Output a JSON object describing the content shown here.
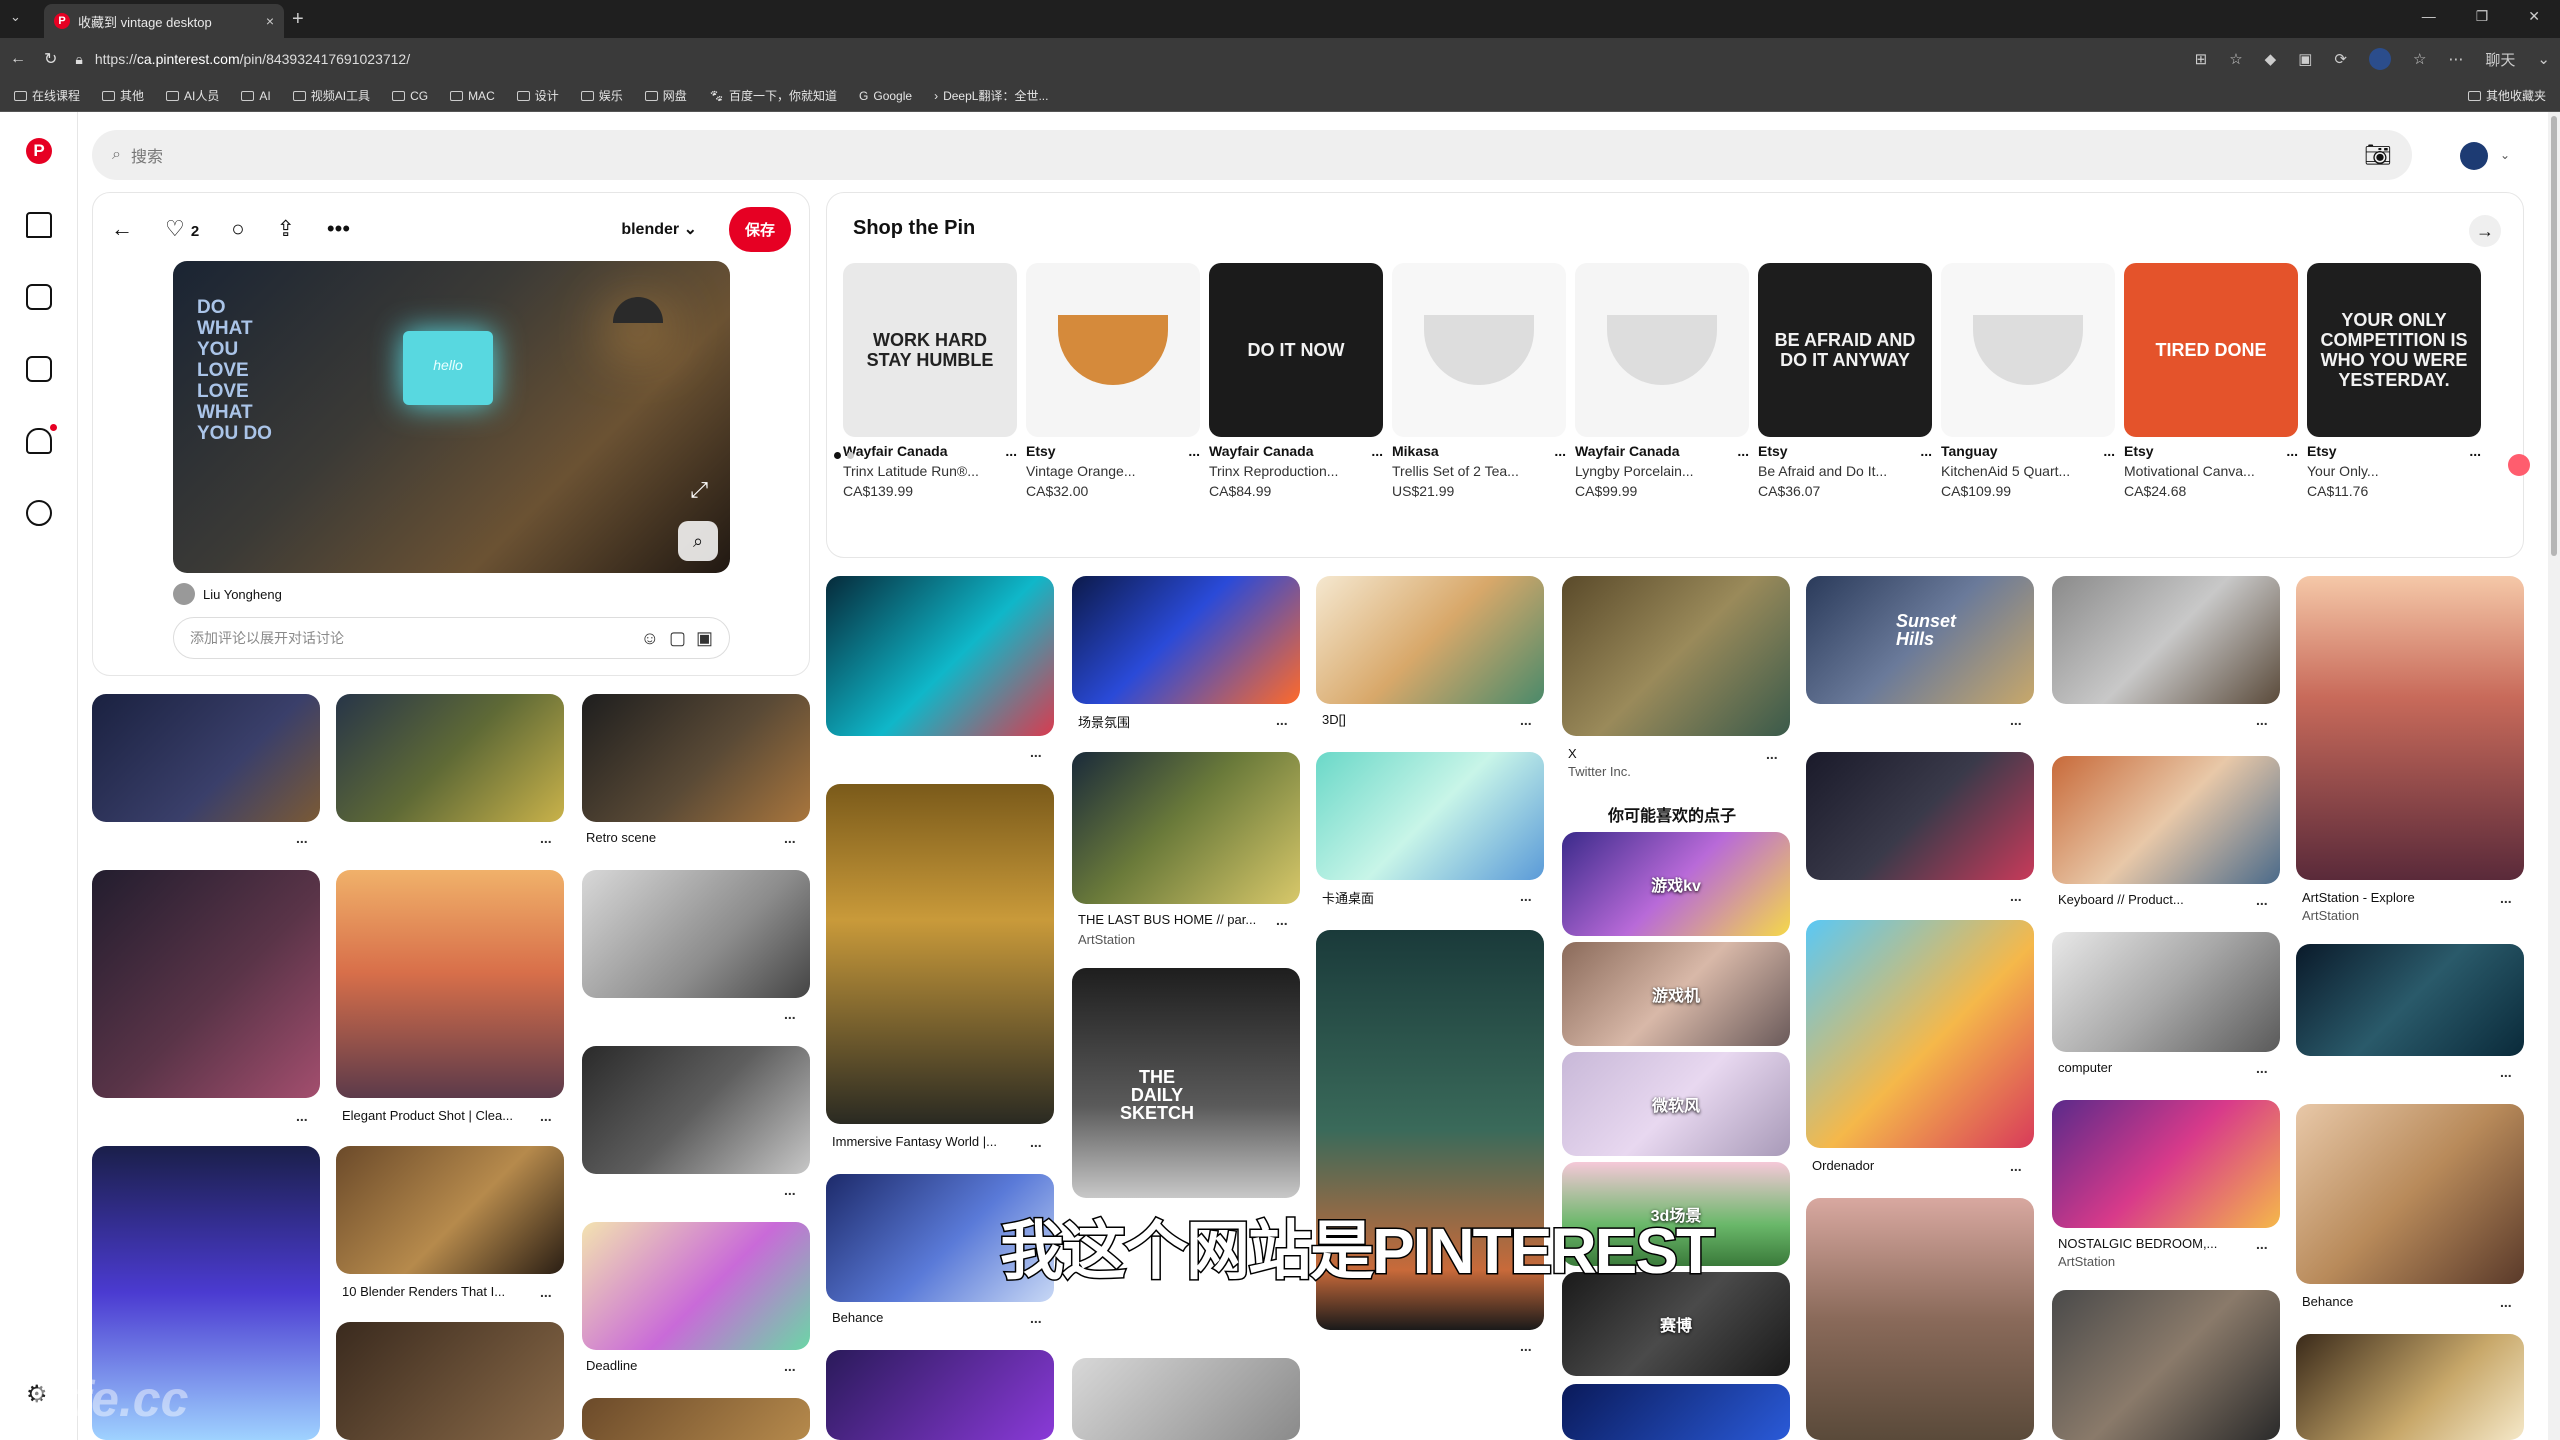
{
  "browser": {
    "tab_title": "收藏到 vintage desktop",
    "tab_close": "×",
    "new_tab": "+",
    "url_prefix": "https://",
    "url_host": "ca.pinterest.com",
    "url_path": "/pin/843932417691023712/",
    "profile_label": "聊天",
    "bookmarks": [
      "在线课程",
      "其他",
      "AI人员",
      "AI",
      "视频AI工具",
      "CG",
      "MAC",
      "设计",
      "娱乐",
      "网盘",
      "百度一下，你就知道",
      "Google",
      "DeepL翻译：全世..."
    ],
    "bookmarks_right": "其他收藏夹"
  },
  "pinterest": {
    "search_placeholder": "搜索",
    "pin": {
      "likes": "2",
      "board": "blender",
      "save_label": "保存",
      "poster_text": "DO WHAT YOU LOVE LOVE WHAT YOU DO",
      "screen_text": "hello",
      "author": "Liu Yongheng",
      "comment_placeholder": "添加评论以展开对话讨论"
    },
    "shop": {
      "title": "Shop the Pin",
      "products": [
        {
          "merchant": "Wayfair Canada",
          "title": "Trinx Latitude Run®...",
          "price": "CA$139.99",
          "art": "WORK HARD STAY HUMBLE",
          "bg": "#e9e9e9",
          "fg": "#222"
        },
        {
          "merchant": "Etsy",
          "title": "Vintage Orange...",
          "price": "CA$32.00",
          "art": "",
          "bg": "#f5f5f5",
          "fg": "#d58a3b"
        },
        {
          "merchant": "Wayfair Canada",
          "title": "Trinx Reproduction...",
          "price": "CA$84.99",
          "art": "DO IT NOW",
          "bg": "#1b1b1b",
          "fg": "#f2f2f2"
        },
        {
          "merchant": "Mikasa",
          "title": "Trellis Set of 2 Tea...",
          "price": "US$21.99",
          "art": "",
          "bg": "#f7f7f7",
          "fg": "#ddd"
        },
        {
          "merchant": "Wayfair Canada",
          "title": "Lyngby Porcelain...",
          "price": "CA$99.99",
          "art": "",
          "bg": "#f5f5f5",
          "fg": "#ddd"
        },
        {
          "merchant": "Etsy",
          "title": "Be Afraid and Do It...",
          "price": "CA$36.07",
          "art": "BE AFRAID AND DO IT ANYWAY",
          "bg": "#1d1d1d",
          "fg": "#f2f2f2"
        },
        {
          "merchant": "Tanguay",
          "title": "KitchenAid 5 Quart...",
          "price": "CA$109.99",
          "art": "",
          "bg": "#f7f7f7",
          "fg": "#ddd"
        },
        {
          "merchant": "Etsy",
          "title": "Motivational Canva...",
          "price": "CA$24.68",
          "art": "TIRED DONE",
          "bg": "#e4532b",
          "fg": "#fff"
        },
        {
          "merchant": "Etsy",
          "title": "Your Only...",
          "price": "CA$11.76",
          "art": "YOUR ONLY COMPETITION IS WHO YOU WERE YESTERDAY.",
          "bg": "#1e1e1e",
          "fg": "#f2f2f2"
        }
      ]
    },
    "grid_titles": {
      "retro_scene": "Retro scene",
      "elegant": "Elegant Product Shot | Clea...",
      "blender_renders": "10 Blender Renders That I...",
      "deadline": "Deadline",
      "immersive": "Immersive Fantasy World |...",
      "behance1": "Behance",
      "scene_mood": "场景氛围",
      "bus_home": "THE LAST BUS HOME // par...",
      "bus_source": "ArtStation",
      "daily_sketch": "THE DAILY SKETCH",
      "3d": "3D[]",
      "cartoon_desk": "卡通桌面",
      "x": "X",
      "x_source": "Twitter Inc.",
      "sunset_hills": "Sunset Hills",
      "ordenador": "Ordenador",
      "keyboard": "Keyboard // Product...",
      "computer": "computer",
      "nostalgic": "NOSTALGIC BEDROOM,...",
      "nostalgic_source": "ArtStation",
      "artstation_explore": "ArtStation - Explore",
      "artstation_explore_source": "ArtStation",
      "behance2": "Behance"
    },
    "may_like": {
      "title": "你可能喜欢的点子",
      "chips": [
        "游戏kv",
        "游戏机",
        "微软风",
        "3d场景",
        "赛博"
      ]
    },
    "dots": "..."
  },
  "overlay": {
    "subtitle": "我这个网站是PINTEREST",
    "watermark": "tafe.cc"
  }
}
